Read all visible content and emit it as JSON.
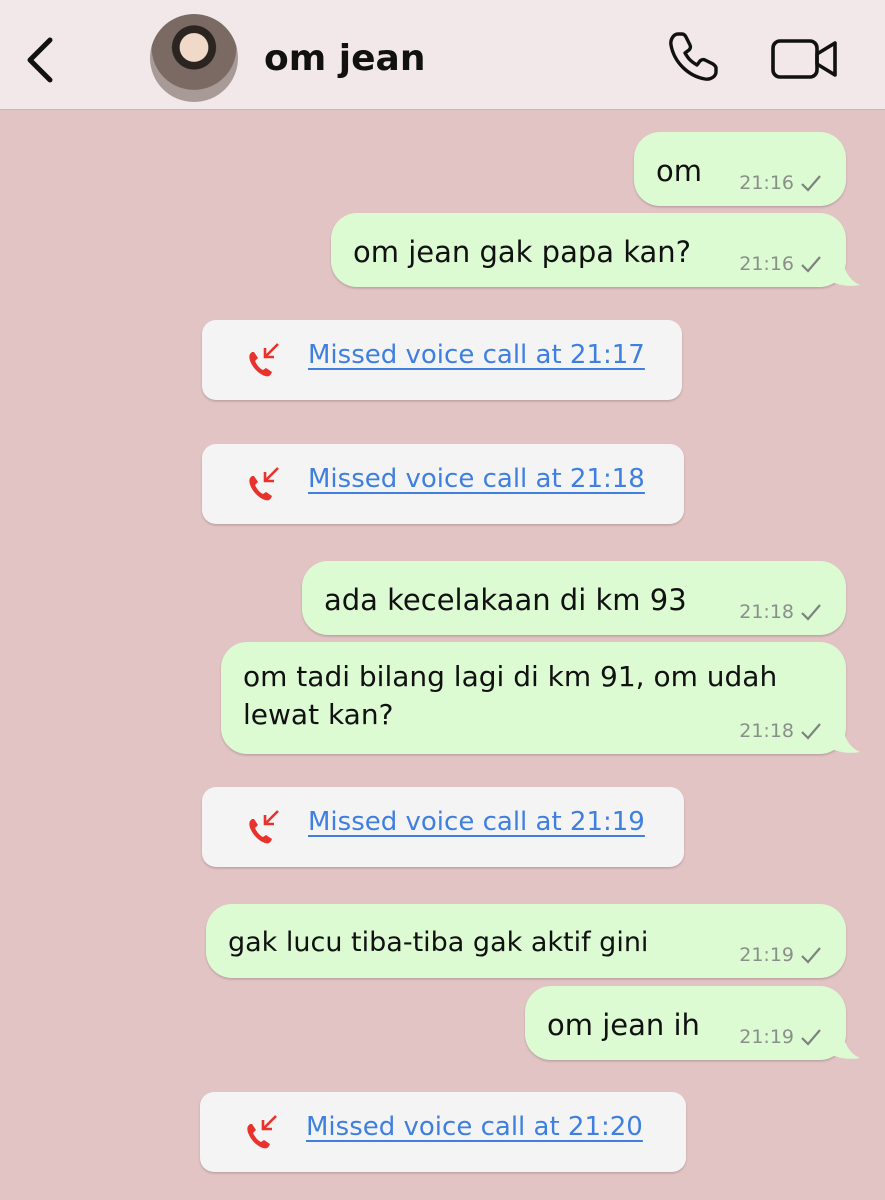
{
  "header": {
    "contact_name": "om jean",
    "back_icon": "chevron-left-icon",
    "call_icon": "phone-icon",
    "video_icon": "video-camera-icon"
  },
  "messages": [
    {
      "text": "om",
      "time": "21:16"
    },
    {
      "text": "om jean gak papa kan?",
      "time": "21:16"
    },
    {
      "text": "ada kecelakaan di km 93",
      "time": "21:18"
    },
    {
      "text_line1": "om tadi bilang lagi di km 91, om udah",
      "text_line2": "lewat kan?",
      "time": "21:18"
    },
    {
      "text": "gak lucu tiba-tiba gak aktif gini",
      "time": "21:19"
    },
    {
      "text": "om jean ih",
      "time": "21:19"
    }
  ],
  "missed_calls": [
    {
      "label": "Missed voice call at 21:17"
    },
    {
      "label": "Missed voice call at 21:18"
    },
    {
      "label": "Missed voice call at 21:19"
    },
    {
      "label": "Missed voice call at 21:20"
    }
  ],
  "colors": {
    "chat_background": "#e3c4c5",
    "outgoing_bubble": "#dcfbd3",
    "missed_call_text": "#3f7fe0",
    "missed_call_icon": "#e8322c"
  }
}
